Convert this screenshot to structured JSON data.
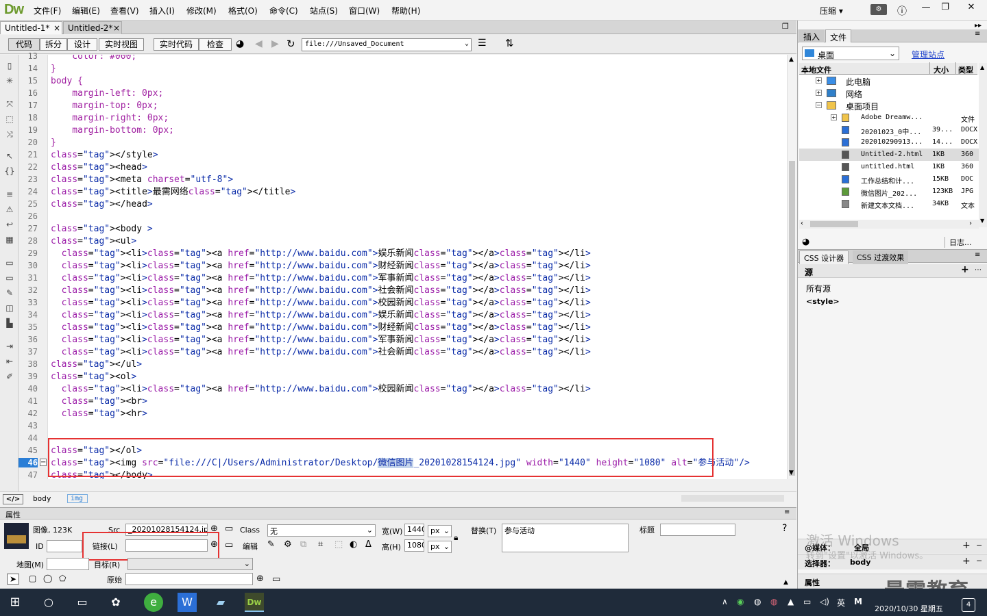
{
  "app": {
    "logo": "Dw",
    "menus": [
      "文件(F)",
      "编辑(E)",
      "查看(V)",
      "插入(I)",
      "修改(M)",
      "格式(O)",
      "命令(C)",
      "站点(S)",
      "窗口(W)",
      "帮助(H)"
    ],
    "layout_label": "压缩"
  },
  "tabs": [
    "Untitled-1*",
    "Untitled-2*"
  ],
  "toolbar": {
    "buttons": [
      "代码",
      "拆分",
      "设计",
      "实时视图",
      "实时代码",
      "检查"
    ],
    "address": "file:///Unsaved_Document"
  },
  "code": {
    "lines": [
      {
        "n": "13",
        "t": "    color: #000;"
      },
      {
        "n": "14",
        "t": "}"
      },
      {
        "n": "15",
        "t": "body {"
      },
      {
        "n": "16",
        "t": "    margin-left: 0px;"
      },
      {
        "n": "17",
        "t": "    margin-top: 0px;"
      },
      {
        "n": "18",
        "t": "    margin-right: 0px;"
      },
      {
        "n": "19",
        "t": "    margin-bottom: 0px;"
      },
      {
        "n": "20",
        "t": "}"
      },
      {
        "n": "21",
        "t": "</style>"
      },
      {
        "n": "22",
        "t": "<head>"
      },
      {
        "n": "23",
        "t": "<meta charset=\"utf-8\">"
      },
      {
        "n": "24",
        "t": "<title>最需网络</title>"
      },
      {
        "n": "25",
        "t": "</head>"
      },
      {
        "n": "26",
        "t": ""
      },
      {
        "n": "27",
        "t": "<body >"
      },
      {
        "n": "28",
        "t": "<ul>"
      },
      {
        "n": "29",
        "t": "  <li><a href=\"http://www.baidu.com\">娱乐新闻</a></li>"
      },
      {
        "n": "30",
        "t": "  <li><a href=\"http://www.baidu.com\">财经新闻</a></li>"
      },
      {
        "n": "31",
        "t": "  <li><a href=\"http://www.baidu.com\">军事新闻</a></li>"
      },
      {
        "n": "32",
        "t": "  <li><a href=\"http://www.baidu.com\">社会新闻</a></li>"
      },
      {
        "n": "33",
        "t": "  <li><a href=\"http://www.baidu.com\">校园新闻</a></li>"
      },
      {
        "n": "34",
        "t": "  <li><a href=\"http://www.baidu.com\">娱乐新闻</a></li>"
      },
      {
        "n": "35",
        "t": "  <li><a href=\"http://www.baidu.com\">财经新闻</a></li>"
      },
      {
        "n": "36",
        "t": "  <li><a href=\"http://www.baidu.com\">军事新闻</a></li>"
      },
      {
        "n": "37",
        "t": "  <li><a href=\"http://www.baidu.com\">社会新闻</a></li>"
      },
      {
        "n": "38",
        "t": "</ul>"
      },
      {
        "n": "39",
        "t": "<ol>"
      },
      {
        "n": "40",
        "t": "  <li><a href=\"http://www.baidu.com\">校园新闻</a></li>"
      },
      {
        "n": "41",
        "t": "  <br>"
      },
      {
        "n": "42",
        "t": "  <hr>"
      },
      {
        "n": "43",
        "t": ""
      },
      {
        "n": "44",
        "t": ""
      },
      {
        "n": "45",
        "t": "</ol>"
      },
      {
        "n": "46",
        "t": "<img src=\"file:///C|/Users/Administrator/Desktop/微信图片_20201028154124.jpg\" width=\"1440\" height=\"1080\" alt=\"参与活动\"/>"
      },
      {
        "n": "47",
        "t": "</body>"
      }
    ],
    "current_line": "46"
  },
  "tag_selector": [
    "body",
    "img"
  ],
  "properties": {
    "header": "属性",
    "type_label": "图像, 123K",
    "id_label": "ID",
    "src_label": "Src",
    "src_value": "_20201028154124.jpg",
    "link_label": "链接(L)",
    "link_value": "",
    "class_label": "Class",
    "class_value": "无",
    "edit_label": "编辑",
    "width_label": "宽(W)",
    "width_value": "1440",
    "width_unit": "px",
    "height_label": "高(H)",
    "height_value": "1080",
    "height_unit": "px",
    "alt_label": "替换(T)",
    "alt_value": "参与活动",
    "title_label": "标题",
    "map_label": "地图(M)",
    "target_label": "目标(R)",
    "original_label": "原始"
  },
  "files_panel": {
    "tabs": [
      "插入",
      "文件"
    ],
    "location": "桌面",
    "manage_link": "管理站点",
    "columns": [
      "本地文件",
      "大小",
      "类型"
    ],
    "items": [
      {
        "name": "此电脑",
        "size": "",
        "type": ""
      },
      {
        "name": "网络",
        "size": "",
        "type": ""
      },
      {
        "name": "桌面项目",
        "size": "",
        "type": ""
      },
      {
        "name": "Adobe Dreamw...",
        "size": "",
        "type": "文件"
      },
      {
        "name": "20201023_0中...",
        "size": "39...",
        "type": "DOCX"
      },
      {
        "name": "202010290913...",
        "size": "14...",
        "type": "DOCX"
      },
      {
        "name": "Untitled-2.html",
        "size": "1KB",
        "type": "360"
      },
      {
        "name": "untitled.html",
        "size": "1KB",
        "type": "360"
      },
      {
        "name": "工作总结和计...",
        "size": "15KB",
        "type": "DOC"
      },
      {
        "name": "微信图片_202...",
        "size": "123KB",
        "type": "JPG"
      },
      {
        "name": "新建文本文档...",
        "size": "34KB",
        "type": "文本"
      }
    ],
    "log_button": "日志..."
  },
  "css_panel": {
    "tabs": [
      "CSS 设计器",
      "CSS 过渡效果"
    ],
    "source_header": "源",
    "sources": [
      "所有源",
      "<style>"
    ],
    "media_label": "@媒体：",
    "media_value": "全局",
    "selector_label": "选择器：",
    "selector_value": "body",
    "properties_label": "属性"
  },
  "watermark": {
    "line1": "激活 Windows",
    "line2": "转到\"设置\"以激活 Windows。",
    "brand": "最需教育"
  },
  "taskbar": {
    "ime": "英",
    "datetime": "2020/10/30 星期五",
    "badge": "4"
  }
}
